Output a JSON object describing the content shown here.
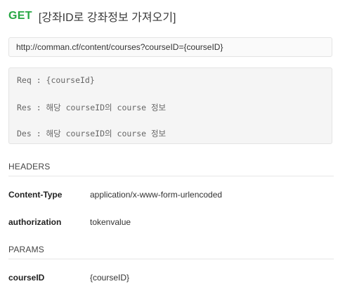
{
  "request": {
    "method": "GET",
    "name": "[강좌ID로 강좌정보 가져오기]",
    "url": "http://comman.cf/content/courses?courseID={courseID}"
  },
  "description": {
    "req": "Req : {courseId}",
    "res": "Res : 해당 courseID의 course 정보",
    "des": "Des : 해당 courseID의 course 정보"
  },
  "headers": {
    "title": "HEADERS",
    "items": [
      {
        "key": "Content-Type",
        "value": "application/x-www-form-urlencoded"
      },
      {
        "key": "authorization",
        "value": "tokenvalue"
      }
    ]
  },
  "params": {
    "title": "PARAMS",
    "items": [
      {
        "key": "courseID",
        "value": "{courseID}"
      }
    ]
  },
  "colors": {
    "method_get": "#27a744"
  }
}
